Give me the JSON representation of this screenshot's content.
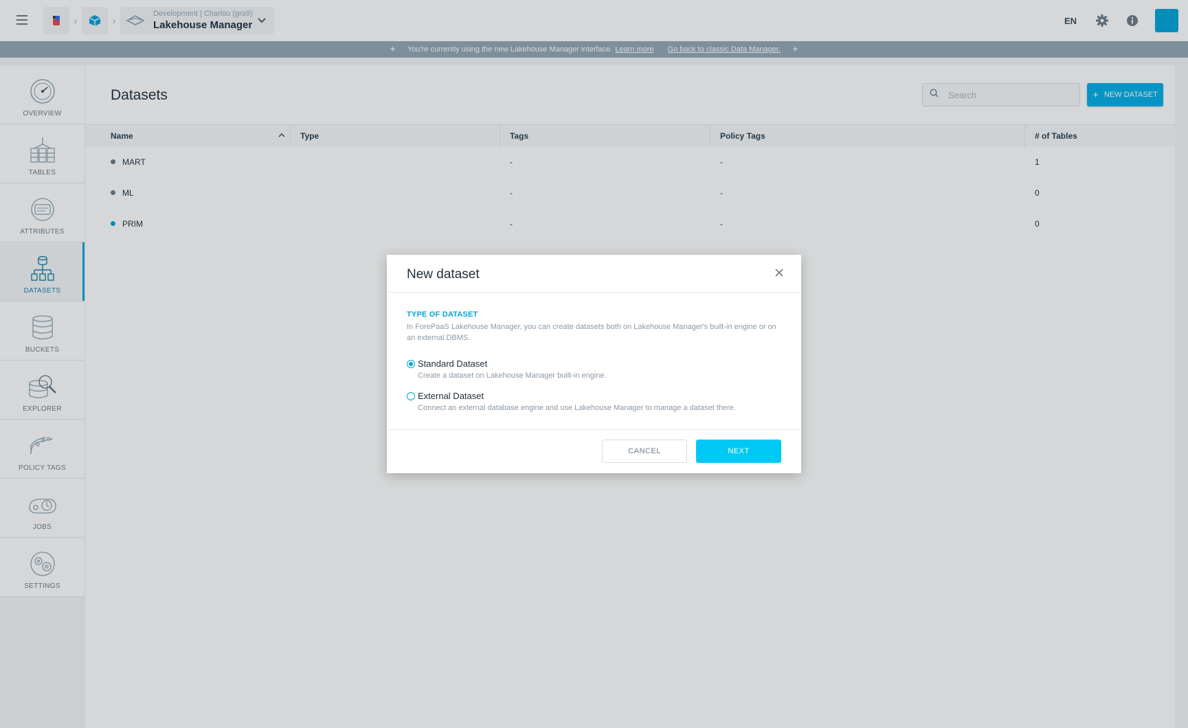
{
  "topbar": {
    "menu_icon": "hamburger-icon",
    "crumb_icons": [
      "forepaas-logo-icon",
      "project-cube-icon",
      "lakehouse-icon"
    ],
    "project_env": "Development | Charlou (gra9)",
    "project_name": "Lakehouse Manager",
    "language": "EN",
    "settings_icon": "gear-icon",
    "info_icon": "info-icon"
  },
  "banner": {
    "message": "You're currently using the new Lakehouse Manager interface.",
    "learn_more": "Learn more",
    "go_back": "Go back to classic Data Manager."
  },
  "sidebar": {
    "items": [
      {
        "label": "OVERVIEW",
        "icon": "overview-icon",
        "active": false
      },
      {
        "label": "TABLES",
        "icon": "tables-icon",
        "active": false
      },
      {
        "label": "ATTRIBUTES",
        "icon": "attributes-icon",
        "active": false
      },
      {
        "label": "DATASETS",
        "icon": "datasets-icon",
        "active": true
      },
      {
        "label": "BUCKETS",
        "icon": "buckets-icon",
        "active": false
      },
      {
        "label": "EXPLORER",
        "icon": "explorer-icon",
        "active": false
      },
      {
        "label": "POLICY TAGS",
        "icon": "policy-tags-icon",
        "active": false
      },
      {
        "label": "JOBS",
        "icon": "jobs-icon",
        "active": false
      },
      {
        "label": "SETTINGS",
        "icon": "settings-icon",
        "active": false
      }
    ]
  },
  "main": {
    "title": "Datasets",
    "search_placeholder": "Search",
    "new_button": "NEW DATASET",
    "columns": [
      "Name",
      "Type",
      "Tags",
      "Policy Tags",
      "# of Tables"
    ],
    "rows": [
      {
        "name": "MART",
        "type": "",
        "tags": "-",
        "policy_tags": "-",
        "tables": "1",
        "dot_color": "#6b7b88"
      },
      {
        "name": "ML",
        "type": "",
        "tags": "-",
        "policy_tags": "-",
        "tables": "0",
        "dot_color": "#6b7b88"
      },
      {
        "name": "PRIM",
        "type": "",
        "tags": "-",
        "policy_tags": "-",
        "tables": "0",
        "dot_color": "#00a3d9"
      }
    ]
  },
  "modal": {
    "title": "New dataset",
    "section_title": "TYPE OF DATASET",
    "section_desc": "In ForePaaS Lakehouse Manager, you can create datasets both on Lakehouse Manager's built-in engine or on an external DBMS.",
    "options": [
      {
        "label": "Standard Dataset",
        "desc": "Create a dataset on Lakehouse Manager built-in engine.",
        "selected": true
      },
      {
        "label": "External Dataset",
        "desc": "Connect an external database engine and use Lakehouse Manager to manage a dataset there.",
        "selected": false
      }
    ],
    "cancel": "CANCEL",
    "next": "NEXT"
  },
  "colors": {
    "accent": "#00a3d9",
    "next_button": "#00c8f5",
    "banner": "#94a7b6"
  }
}
